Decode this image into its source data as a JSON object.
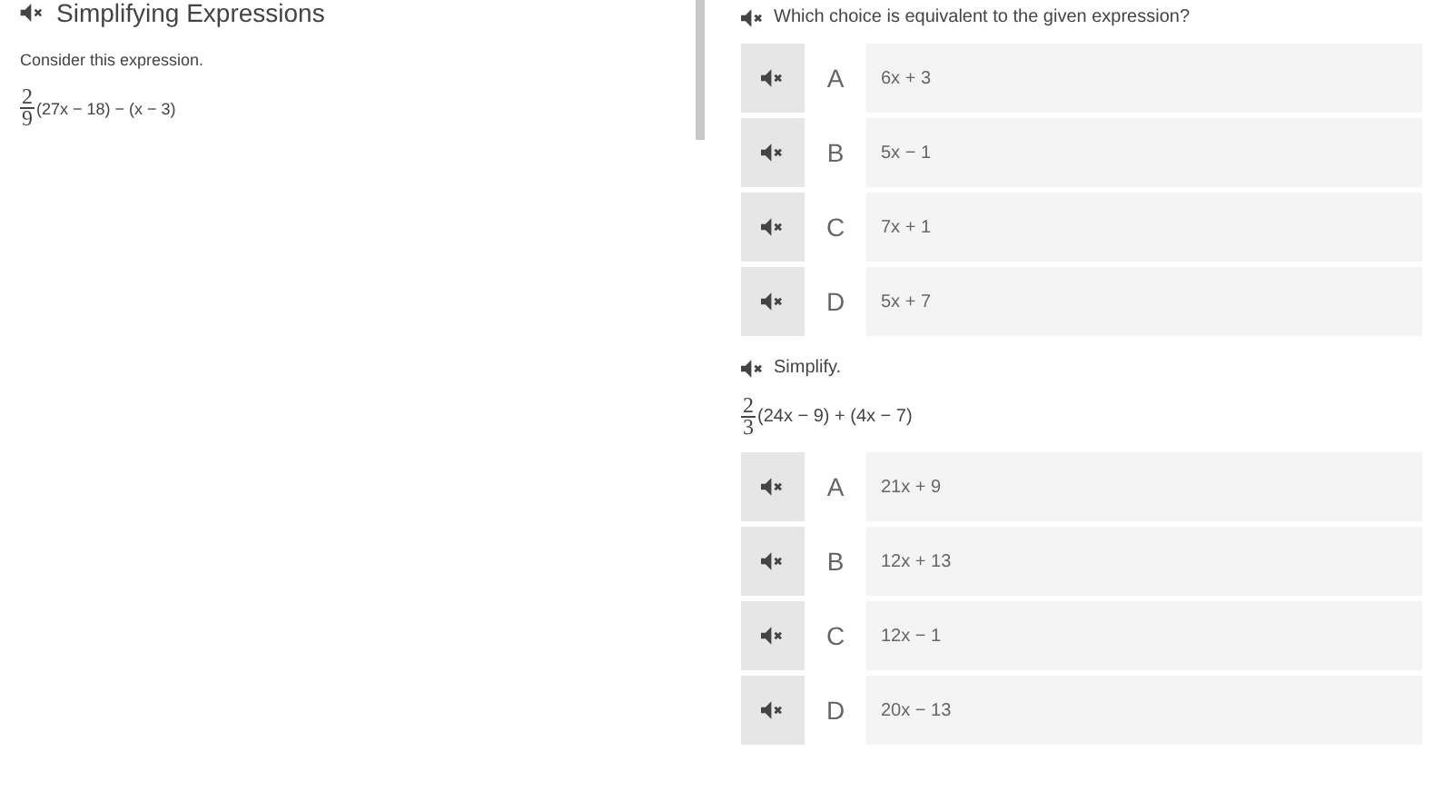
{
  "title": "Simplifying Expressions",
  "intro": "Consider this expression.",
  "expression": {
    "numerator": "2",
    "denominator": "9",
    "rest": "(27x − 18) − (x − 3)"
  },
  "questions": [
    {
      "prompt": "Which choice is equivalent to the given expression?",
      "choices": [
        {
          "letter": "A",
          "text": "6x + 3"
        },
        {
          "letter": "B",
          "text": "5x − 1"
        },
        {
          "letter": "C",
          "text": "7x + 1"
        },
        {
          "letter": "D",
          "text": "5x + 7"
        }
      ]
    },
    {
      "prompt": "Simplify.",
      "expression": {
        "numerator": "2",
        "denominator": "3",
        "rest": "(24x − 9) + (4x − 7)"
      },
      "choices": [
        {
          "letter": "A",
          "text": "21x + 9"
        },
        {
          "letter": "B",
          "text": "12x + 13"
        },
        {
          "letter": "C",
          "text": "12x − 1"
        },
        {
          "letter": "D",
          "text": "20x − 13"
        }
      ]
    }
  ]
}
